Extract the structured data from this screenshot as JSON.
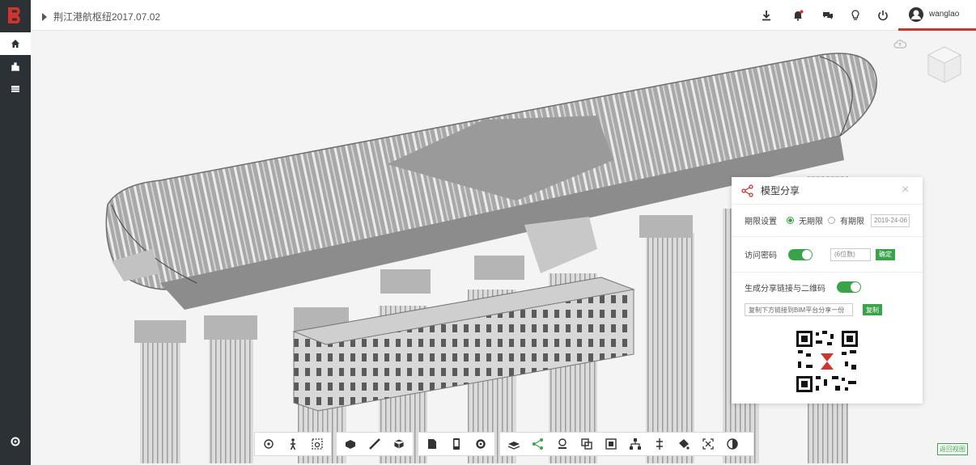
{
  "app": {
    "project_title": "荆江港航枢纽2017.07.02",
    "user": {
      "name": "wanglao"
    }
  },
  "colors": {
    "brand_red": "#d0342c",
    "sidebar_bg": "#2c3136",
    "accent_green": "#3aa34a"
  },
  "sidebar": {
    "items": [
      {
        "name": "home",
        "icon": "home-icon",
        "active": true
      },
      {
        "name": "chart",
        "icon": "bar-chart-icon",
        "active": false
      },
      {
        "name": "list",
        "icon": "list-icon",
        "active": false
      },
      {
        "name": "settings",
        "icon": "gear-icon",
        "active": false
      }
    ]
  },
  "topbar": {
    "icons": [
      "download-icon",
      "bell-icon",
      "chat-icon",
      "lightbulb-icon",
      "power-icon"
    ]
  },
  "share_panel": {
    "title": "模型分享",
    "period_label": "期限设置",
    "option_permanent": "无期限",
    "option_limited": "有期限",
    "date_value": "2019-24-06",
    "access_label": "访问密码",
    "code_placeholder": "(6位数)",
    "generate_label": "确定",
    "qr_label": "生成分享链接与二维码",
    "share_link": "复制下方链接到BIM平台分享一份",
    "copy_label": "复制"
  },
  "toolbar": {
    "groups": [
      [
        "orbit-icon",
        "walk-icon",
        "camera-icon"
      ],
      [
        "model-icon",
        "measure-icon",
        "cube-icon"
      ],
      [
        "document-icon",
        "phone-icon",
        "gear-icon"
      ],
      [
        "layers-icon",
        "share-icon",
        "section-icon",
        "overlap-icon",
        "solid-icon",
        "tree-icon",
        "explode-icon",
        "paint-icon",
        "fit-icon",
        "contrast-icon"
      ]
    ],
    "active": "share-icon"
  },
  "corner": {
    "label": "返回视图"
  }
}
